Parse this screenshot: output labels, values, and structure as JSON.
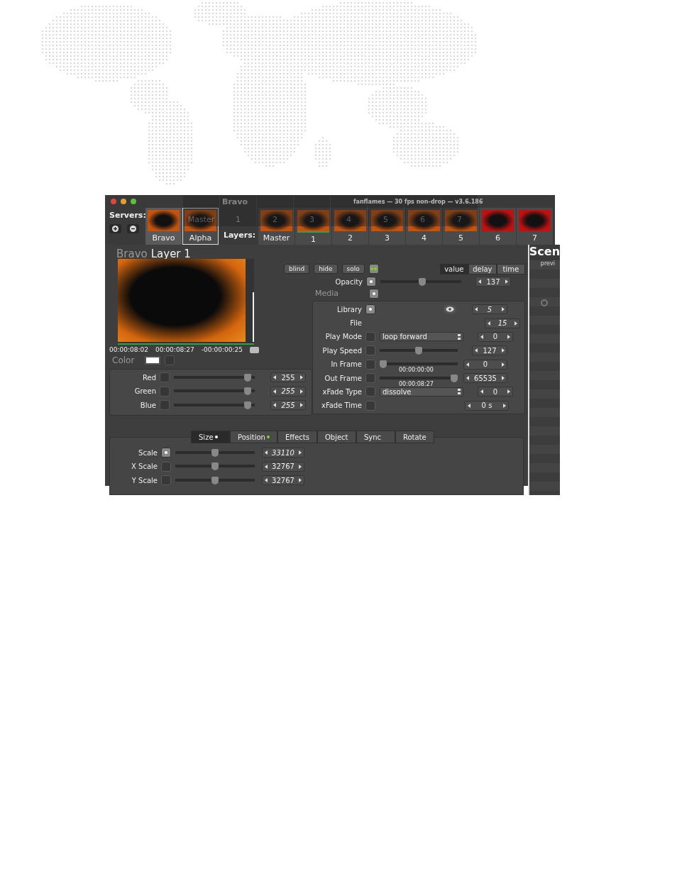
{
  "window": {
    "title": "fanflames  —  30 fps non-drop  —  v3.6.186"
  },
  "servers": {
    "label": "Servers:",
    "items": [
      {
        "name": "Bravo",
        "selected": true
      },
      {
        "name": "Alpha",
        "selected": false
      }
    ]
  },
  "layers": {
    "label": "Layers:",
    "items": [
      "Master",
      "1",
      "2",
      "3",
      "4",
      "5",
      "6",
      "7"
    ]
  },
  "drag_ghost": {
    "title": "Bravo",
    "items": [
      "Master",
      "1",
      "2",
      "3",
      "4",
      "5",
      "6",
      "7"
    ]
  },
  "layer": {
    "server": "Bravo",
    "name": "Layer 1",
    "timecodes": [
      "00:00:08:02",
      "00:00:08:27",
      "-00:00:00:25"
    ],
    "color_label": "Color"
  },
  "color_rows": [
    {
      "label": "Red",
      "level": 0.95,
      "value": "255",
      "italic": false
    },
    {
      "label": "Green",
      "level": 0.95,
      "value": "255",
      "italic": true
    },
    {
      "label": "Blue",
      "level": 0.95,
      "value": "255",
      "italic": true
    }
  ],
  "buttons": [
    "blind",
    "hide",
    "solo"
  ],
  "modes": [
    {
      "label": "value",
      "selected": true
    },
    {
      "label": "delay",
      "selected": false
    },
    {
      "label": "time",
      "selected": false
    }
  ],
  "opacity": {
    "label": "Opacity",
    "lit": true,
    "level": 0.52,
    "value": "137",
    "italic": false
  },
  "media": {
    "label": "Media",
    "lit": true
  },
  "media_rows": [
    {
      "label": "Library",
      "lit": true,
      "kind": "eye",
      "value": "5",
      "italic": true
    },
    {
      "label": "File",
      "kind": "none",
      "value": "15",
      "italic": true
    },
    {
      "label": "Play Mode",
      "lit": false,
      "kind": "select",
      "option": "loop forward",
      "value": "0",
      "italic": false
    },
    {
      "label": "Play Speed",
      "lit": false,
      "kind": "slider",
      "level": 0.5,
      "value": "127",
      "italic": false
    },
    {
      "label": "In Frame",
      "lit": false,
      "kind": "slider",
      "level": 0.0,
      "timecode": "00:00:00:00",
      "value": "0",
      "italic": false
    },
    {
      "label": "Out Frame",
      "lit": false,
      "kind": "slider",
      "level": 1.0,
      "timecode": "00:00:08:27",
      "value": "65535",
      "italic": false
    },
    {
      "label": "xFade Type",
      "lit": false,
      "kind": "select",
      "option": "dissolve",
      "value": "0",
      "italic": false
    },
    {
      "label": "xFade Time",
      "lit": false,
      "kind": "none",
      "value": "0 s",
      "italic": false
    }
  ],
  "tabs": [
    {
      "label": "Size",
      "color": "#ffffff",
      "selected": true
    },
    {
      "label": "Position",
      "color": "#7ed321",
      "selected": false
    },
    {
      "label": "Effects",
      "selected": false
    },
    {
      "label": "Object",
      "selected": false
    },
    {
      "label": "Sync",
      "selected": false
    },
    {
      "label": "Rotate",
      "selected": false
    }
  ],
  "size_rows": [
    {
      "label": "Scale",
      "lit": true,
      "level": 0.5,
      "value": "33110",
      "italic": true
    },
    {
      "label": "X Scale",
      "lit": false,
      "level": 0.5,
      "value": "32767",
      "italic": false
    },
    {
      "label": "Y Scale",
      "lit": false,
      "level": 0.5,
      "value": "32767",
      "italic": false
    }
  ],
  "scene_panel": {
    "title": "Scen",
    "column": "previ"
  }
}
